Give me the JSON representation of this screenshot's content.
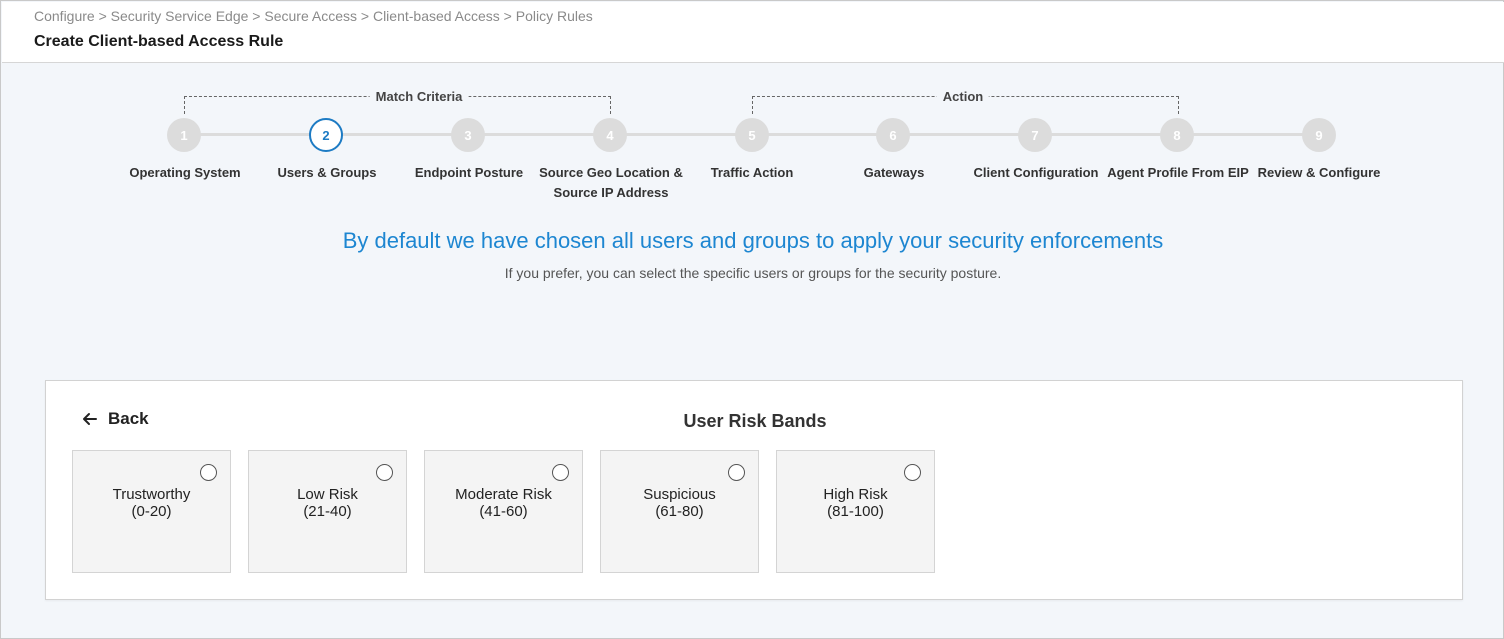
{
  "breadcrumb": [
    "Configure",
    "Security Service Edge",
    "Secure Access",
    "Client-based Access",
    "Policy Rules"
  ],
  "breadcrumb_separator": " > ",
  "page_title": "Create Client-based Access Rule",
  "stepper": {
    "groups": [
      {
        "label": "Match Criteria"
      },
      {
        "label": "Action"
      }
    ],
    "active_step": 2,
    "steps": [
      {
        "number": "1",
        "label": "Operating System"
      },
      {
        "number": "2",
        "label": "Users & Groups"
      },
      {
        "number": "3",
        "label": "Endpoint Posture"
      },
      {
        "number": "4",
        "label": "Source Geo Location & Source IP Address"
      },
      {
        "number": "5",
        "label": "Traffic Action"
      },
      {
        "number": "6",
        "label": "Gateways"
      },
      {
        "number": "7",
        "label": "Client Configuration"
      },
      {
        "number": "8",
        "label": "Agent Profile From EIP"
      },
      {
        "number": "9",
        "label": "Review & Configure"
      }
    ]
  },
  "headline": "By default we have chosen all users and groups to apply your security enforcements",
  "subline": "If you prefer, you can select the specific users or groups for the security posture.",
  "panel": {
    "back_label": "Back",
    "title": "User Risk Bands",
    "bands": [
      {
        "name": "Trustworthy",
        "range": "(0-20)",
        "selected": false
      },
      {
        "name": "Low Risk",
        "range": "(21-40)",
        "selected": false
      },
      {
        "name": "Moderate Risk",
        "range": "(41-60)",
        "selected": false
      },
      {
        "name": "Suspicious",
        "range": "(61-80)",
        "selected": false
      },
      {
        "name": "High Risk",
        "range": "(81-100)",
        "selected": false
      }
    ]
  },
  "colors": {
    "accent": "#1d86d1",
    "step_inactive": "#dcdcdc",
    "background": "#f3f6fa"
  },
  "icons": {
    "back": "arrow-left-icon",
    "radio": "radio-unselected-icon"
  }
}
